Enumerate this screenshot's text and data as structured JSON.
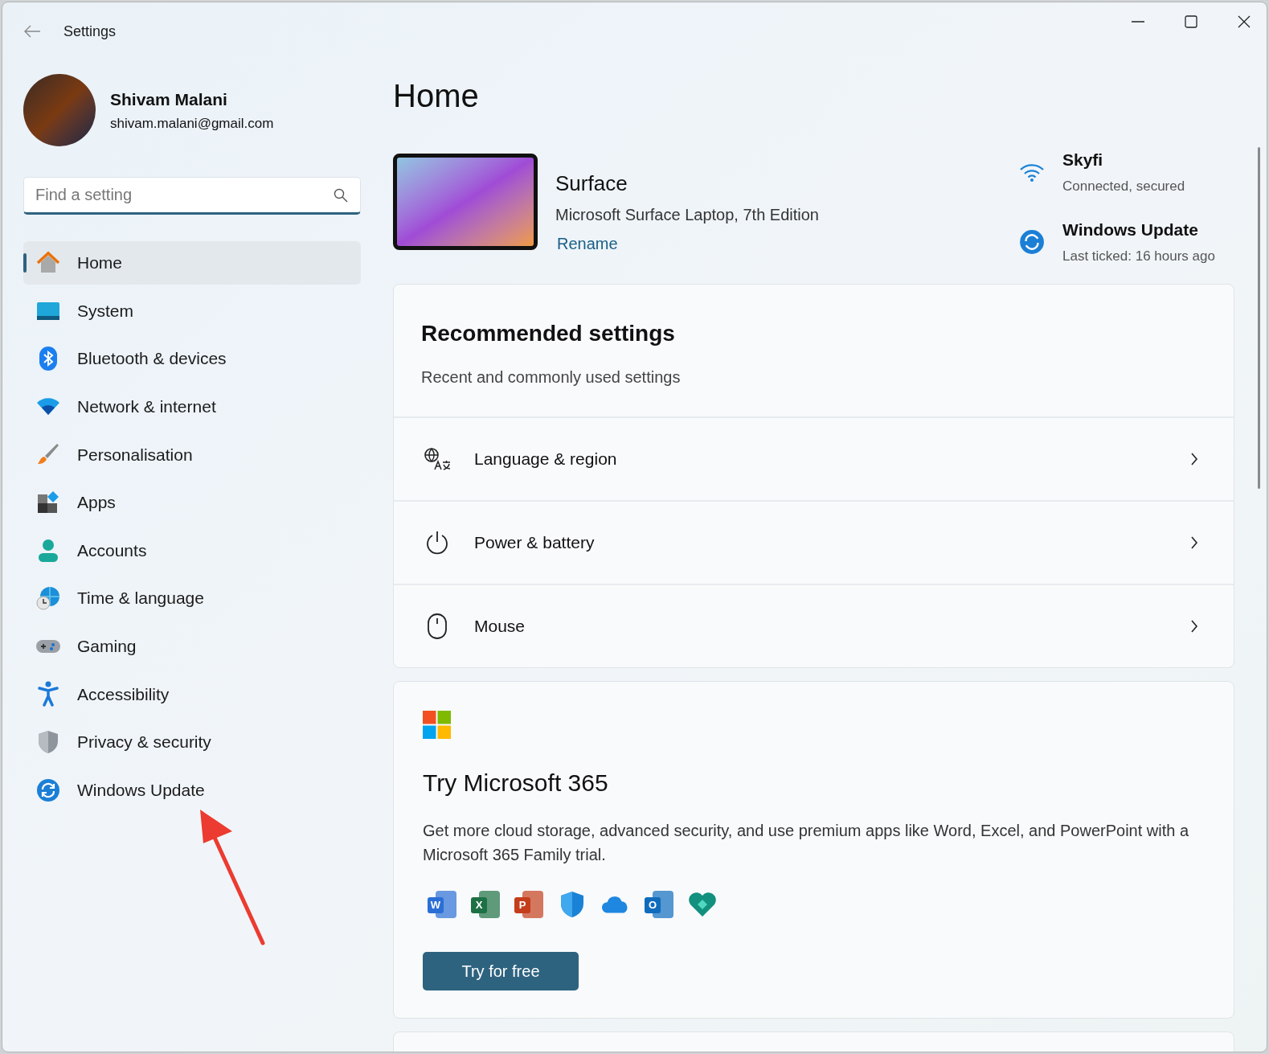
{
  "window": {
    "title": "Settings"
  },
  "profile": {
    "name": "Shivam Malani",
    "email": "shivam.malani@gmail.com"
  },
  "search": {
    "placeholder": "Find a setting"
  },
  "nav": [
    {
      "label": "Home",
      "selected": true
    },
    {
      "label": "System",
      "selected": false
    },
    {
      "label": "Bluetooth & devices",
      "selected": false
    },
    {
      "label": "Network & internet",
      "selected": false
    },
    {
      "label": "Personalisation",
      "selected": false
    },
    {
      "label": "Apps",
      "selected": false
    },
    {
      "label": "Accounts",
      "selected": false
    },
    {
      "label": "Time & language",
      "selected": false
    },
    {
      "label": "Gaming",
      "selected": false
    },
    {
      "label": "Accessibility",
      "selected": false
    },
    {
      "label": "Privacy & security",
      "selected": false
    },
    {
      "label": "Windows Update",
      "selected": false
    }
  ],
  "page_title": "Home",
  "device": {
    "name": "Surface",
    "model": "Microsoft Surface Laptop, 7th Edition",
    "rename": "Rename"
  },
  "status": [
    {
      "title": "Skyfi",
      "detail": "Connected, secured"
    },
    {
      "title": "Windows Update",
      "detail": "Last ticked: 16 hours ago"
    }
  ],
  "recommended": {
    "title": "Recommended settings",
    "subtitle": "Recent and commonly used settings",
    "rows": [
      {
        "label": "Language & region"
      },
      {
        "label": "Power & battery"
      },
      {
        "label": "Mouse"
      }
    ]
  },
  "promo": {
    "title": "Try Microsoft 365",
    "body": "Get more cloud storage, advanced security, and use premium apps like Word, Excel, and PowerPoint with a Microsoft 365 Family trial.",
    "button": "Try for free",
    "app_icons": [
      {
        "kind": "letter",
        "letter": "W",
        "color": "#2b6fd6"
      },
      {
        "kind": "letter",
        "letter": "X",
        "color": "#1e7145"
      },
      {
        "kind": "letter",
        "letter": "P",
        "color": "#c43e1c"
      },
      {
        "kind": "glyph"
      },
      {
        "kind": "glyph"
      },
      {
        "kind": "letter",
        "letter": "O",
        "color": "#0f6cbd"
      },
      {
        "kind": "glyph"
      }
    ]
  }
}
